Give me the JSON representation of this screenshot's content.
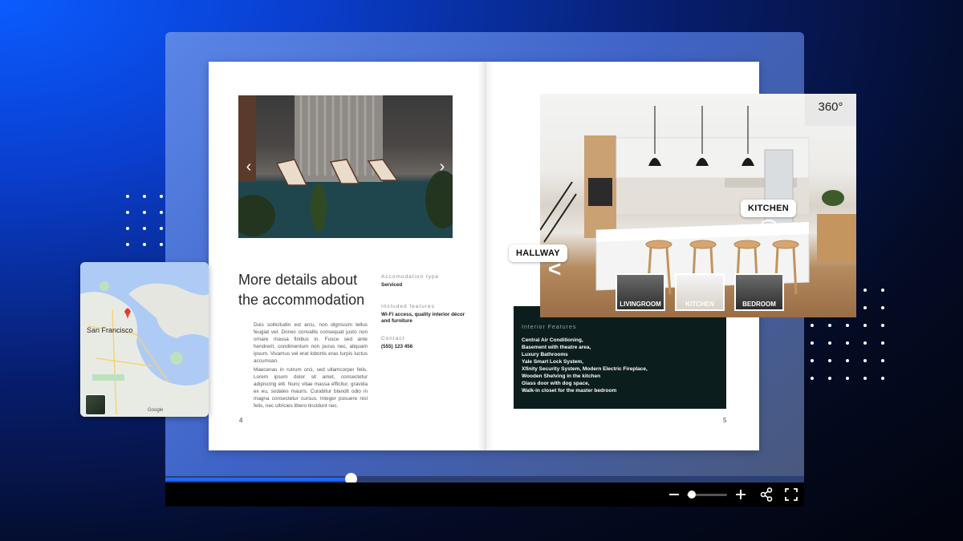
{
  "accent_color": "#1e6bff",
  "brochure": {
    "left_page": {
      "title": "More details about the accommodation",
      "paragraph_1": "Duis sollicitudin est arcu, non dignissim tellus feugiat vel. Donec convallis consequat justo non ornare massa finibus in. Fusce sed ante hendrerit, condimentum non purus nec, aliquam ipsum. Vivamus vel erat lobortis eras turpis luctus accumsan.",
      "paragraph_2": "Maecenas in rutrum orci, sed ullamcorper felis. Lorem ipsum dolor sit amet, consectetur adipiscing elit. Nunc vitae massa efficitur, gravida ex eu, sodales mauris. Curabitur blandit odio in magna consectetur cursus. Integer posuere nisl felis, nec ultricies libero tincidunt nec.",
      "type_label": "Accomodation type",
      "type_value": "Serviced",
      "features_label": "Included features",
      "features_value": "Wi-Fi access, quality interior décor and furniture",
      "contact_label": "Contact",
      "contact_value": "(555) 123 456",
      "page_number": "4"
    },
    "right_page": {
      "interior_label": "Interior Features",
      "interior_items": [
        "Central Air Conditioning,",
        "Basement with theatre area,",
        "Luxury Bathrooms",
        "Yale Smart Lock System,",
        "Xfinity Security System, Modern Electric Fireplace,",
        "Wooden Shelving in the kitchen",
        "Glass door with dog space,",
        "Walk-in closet for the master bedroom"
      ],
      "page_number": "5"
    }
  },
  "tour": {
    "badge": "360°",
    "hotspots": {
      "kitchen": "KITCHEN",
      "hallway": "HALLWAY"
    },
    "thumbnails": [
      "LIVINGROOM",
      "KITCHEN",
      "BEDROOM"
    ]
  },
  "map": {
    "city_label": "San Francisco",
    "google_label": "Google"
  },
  "player": {
    "progress": 0.29,
    "zoom_level": 0.08
  }
}
